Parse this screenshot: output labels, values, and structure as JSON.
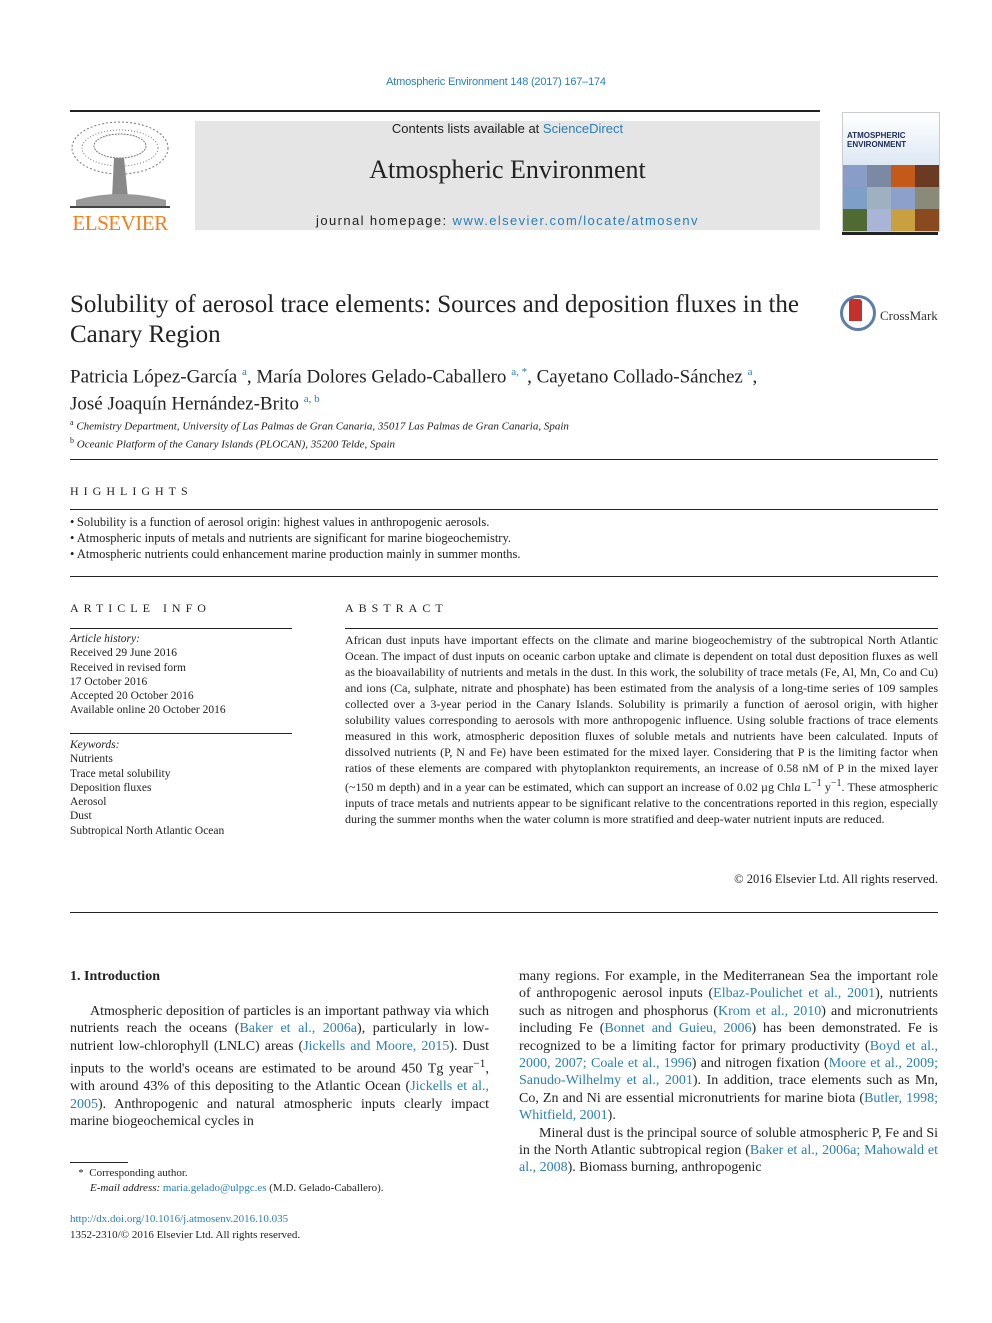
{
  "header": {
    "citation": "Atmospheric Environment 148 (2017) 167–174",
    "contents_prefix": "Contents lists available at ",
    "contents_link": "ScienceDirect",
    "journal_title": "Atmospheric Environment",
    "homepage_prefix": "journal homepage: ",
    "homepage_link": "www.elsevier.com/locate/atmosenv",
    "publisher_logo_text": "ELSEVIER",
    "cover_title_line1": "ATMOSPHERIC",
    "cover_title_line2": "ENVIRONMENT",
    "crossmark_label": "CrossMark",
    "colors": {
      "link": "#2a7fb5",
      "elsevier_orange": "#f07f1c",
      "banner_bg": "#e5e5e5"
    }
  },
  "article": {
    "title": "Solubility of aerosol trace elements: Sources and deposition fluxes in the Canary Region",
    "authors": [
      {
        "name": "Patricia López-García",
        "affil": "a",
        "sep": ", "
      },
      {
        "name": "María Dolores Gelado-Caballero",
        "affil": "a, *",
        "sep": ", "
      },
      {
        "name": "Cayetano Collado-Sánchez",
        "affil": "a",
        "sep": ","
      },
      {
        "name": "José Joaquín Hernández-Brito",
        "affil": "a, b",
        "sep": ""
      }
    ],
    "affiliations": [
      {
        "key": "a",
        "text": "Chemistry Department, University of Las Palmas de Gran Canaria, 35017 Las Palmas de Gran Canaria, Spain"
      },
      {
        "key": "b",
        "text": "Oceanic Platform of the Canary Islands (PLOCAN), 35200 Telde, Spain"
      }
    ]
  },
  "highlights": {
    "heading": "HIGHLIGHTS",
    "items": [
      "Solubility is a function of aerosol origin: highest values in anthropogenic aerosols.",
      "Atmospheric inputs of metals and nutrients are significant for marine biogeochemistry.",
      "Atmospheric nutrients could enhancement marine production mainly in summer months."
    ]
  },
  "article_info": {
    "heading": "ARTICLE INFO",
    "history_label": "Article history:",
    "history": [
      "Received 29 June 2016",
      "Received in revised form",
      "17 October 2016",
      "Accepted 20 October 2016",
      "Available online 20 October 2016"
    ],
    "keywords_label": "Keywords:",
    "keywords": [
      "Nutrients",
      "Trace metal solubility",
      "Deposition fluxes",
      "Aerosol",
      "Dust",
      "Subtropical North Atlantic Ocean"
    ]
  },
  "abstract": {
    "heading": "ABSTRACT",
    "text_part1": "African dust inputs have important effects on the climate and marine biogeochemistry of the subtropical North Atlantic Ocean. The impact of dust inputs on oceanic carbon uptake and climate is dependent on total dust deposition fluxes as well as the bioavailability of nutrients and metals in the dust. In this work, the solubility of trace metals (Fe, Al, Mn, Co and Cu) and ions (Ca, sulphate, nitrate and phosphate) has been estimated from the analysis of a long-time series of 109 samples collected over a 3-year period in the Canary Islands. Solubility is primarily a function of aerosol origin, with higher solubility values corresponding to aerosols with more anthropogenic influence. Using soluble fractions of trace elements measured in this work, atmospheric deposition fluxes of soluble metals and nutrients have been calculated. Inputs of dissolved nutrients (P, N and Fe) have been estimated for the mixed layer. Considering that P is the limiting factor when ratios of these elements are compared with phytoplankton requirements, an increase of 0.58 nM of P in the mixed layer (~150 m depth) and in a year can be estimated, which can support an increase of 0.02 µg Chl",
    "chl_a": "a",
    "unit_L": " L",
    "exp1": "−1",
    "unit_y": " y",
    "exp2": "−1",
    "text_part2": ". These atmospheric inputs of trace metals and nutrients appear to be significant relative to the concentrations reported in this region, especially during the summer months when the water column is more stratified and deep-water nutrient inputs are reduced.",
    "copyright": "© 2016 Elsevier Ltd. All rights reserved."
  },
  "introduction": {
    "heading": "1.  Introduction",
    "col1": {
      "t1": "Atmospheric deposition of particles is an important pathway via which nutrients reach the oceans (",
      "c1": "Baker et al., 2006a",
      "t2": "), particularly in low-nutrient low-chlorophyll (LNLC) areas (",
      "c2": "Jickells and Moore, 2015",
      "t3": "). Dust inputs to the world's oceans are estimated to be around 450 Tg year",
      "exp": "−1",
      "t4": ", with around 43% of this depositing to the Atlantic Ocean (",
      "c3": "Jickells et al., 2005",
      "t5": "). Anthropogenic and natural atmospheric inputs clearly impact marine biogeochemical cycles in"
    },
    "col2": {
      "t1": "many regions. For example, in the Mediterranean Sea the important role of anthropogenic aerosol inputs (",
      "c1": "Elbaz-Poulichet et al., 2001",
      "t2": "), nutrients such as nitrogen and phosphorus (",
      "c2": "Krom et al., 2010",
      "t3": ") and micronutrients including Fe (",
      "c3": "Bonnet and Guieu, 2006",
      "t4": ") has been demonstrated. Fe is recognized to be a limiting factor for primary productivity (",
      "c4": "Boyd et al., 2000, 2007; Coale et al., 1996",
      "t5": ") and nitrogen fixation (",
      "c5": "Moore et al., 2009; Sanudo-Wilhelmy et al., 2001",
      "t6": "). In addition, trace elements such as Mn, Co, Zn and Ni are essential micronutrients for marine biota (",
      "c6": "Butler, 1998; Whitfield, 2001",
      "t7": ").",
      "p2_t1": "Mineral dust is the principal source of soluble atmospheric P, Fe and Si in the North Atlantic subtropical region (",
      "p2_c1": "Baker et al., 2006a; Mahowald et al., 2008",
      "p2_t2": "). Biomass burning, anthropogenic"
    }
  },
  "footnote": {
    "marker": "*",
    "corresponding": "Corresponding author.",
    "email_label": "E-mail address:",
    "email": "maria.gelado@ulpgc.es",
    "email_owner": " (M.D. Gelado-Caballero).",
    "doi": "http://dx.doi.org/10.1016/j.atmosenv.2016.10.035",
    "issn_line": "1352-2310/© 2016 Elsevier Ltd. All rights reserved."
  }
}
